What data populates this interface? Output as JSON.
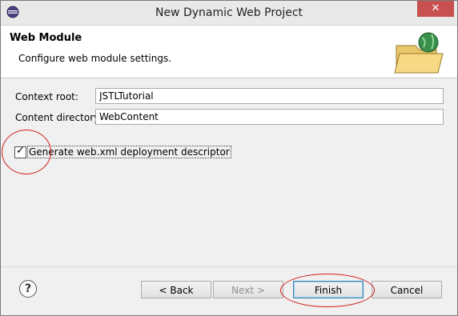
{
  "window": {
    "title": "New Dynamic Web Project"
  },
  "header": {
    "title": "Web Module",
    "description": "Configure web module settings."
  },
  "form": {
    "context_root": {
      "label": "Context root:",
      "value": "JSTLTutorial"
    },
    "content_directory": {
      "label": "Content directory:",
      "value": "WebContent"
    },
    "generate_descriptor": {
      "label": "Generate web.xml deployment descriptor",
      "checked": true
    }
  },
  "buttons": {
    "help": "?",
    "back": "< Back",
    "next": "Next >",
    "finish": "Finish",
    "cancel": "Cancel"
  },
  "icons": {
    "app": "eclipse-icon",
    "close": "close-icon",
    "header": "folder-globe-icon",
    "help": "help-icon"
  },
  "colors": {
    "close_button": "#c75050",
    "annotation": "#d01a1a",
    "default_button_border": "#3c7fb1"
  }
}
